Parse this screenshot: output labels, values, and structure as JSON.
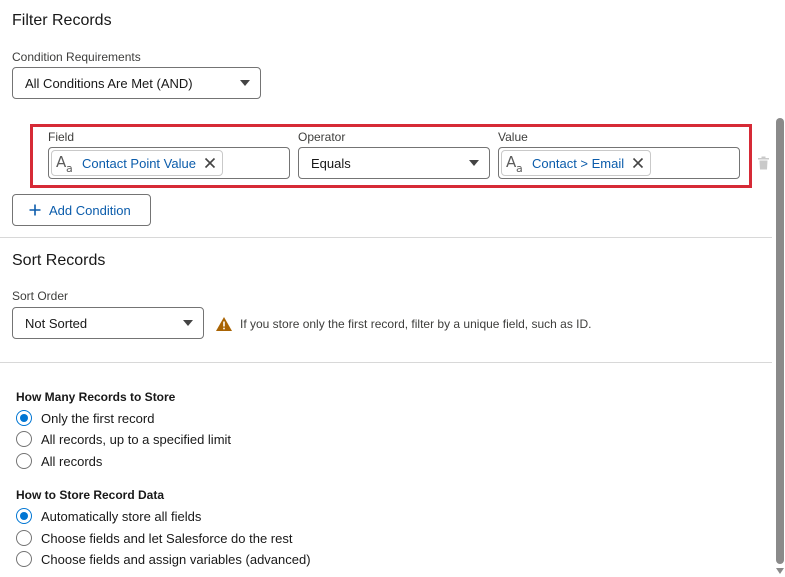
{
  "filter": {
    "title": "Filter Records",
    "condition_label": "Condition Requirements",
    "condition_value": "All Conditions Are Met (AND)",
    "row": {
      "field_label": "Field",
      "field_value": "Contact Point Value",
      "operator_label": "Operator",
      "operator_value": "Equals",
      "value_label": "Value",
      "value_value": "Contact > Email"
    },
    "add_condition": "Add Condition"
  },
  "sort": {
    "title": "Sort Records",
    "order_label": "Sort Order",
    "order_value": "Not Sorted",
    "warning": "If you store only the first record, filter by a unique field, such as ID."
  },
  "store_count": {
    "title": "How Many Records to Store",
    "options": [
      "Only the first record",
      "All records, up to a specified limit",
      "All records"
    ],
    "selected_index": 0
  },
  "store_data": {
    "title": "How to Store Record Data",
    "options": [
      "Automatically store all fields",
      "Choose fields and let Salesforce do the rest",
      "Choose fields and assign variables (advanced)"
    ],
    "selected_index": 0
  },
  "colors": {
    "link_blue": "#0b5cab",
    "brand_blue": "#0176d3",
    "highlight_red": "#d62a36",
    "warning_amber": "#a96404"
  },
  "icons": [
    "text-type-icon",
    "remove-icon",
    "chevron-down-icon",
    "plus-icon",
    "warning-icon",
    "trash-icon"
  ]
}
